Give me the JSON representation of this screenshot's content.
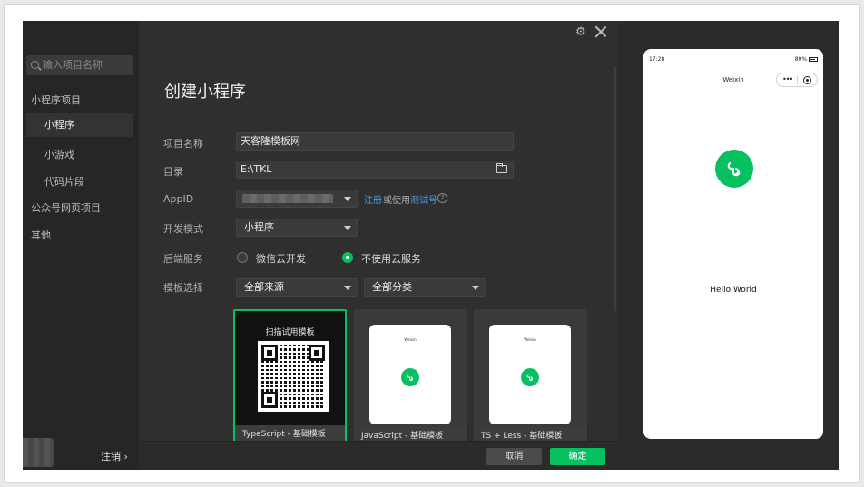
{
  "sidebar": {
    "search_placeholder": "输入项目名称",
    "items": [
      {
        "label": "小程序项目"
      },
      {
        "label": "小程序"
      },
      {
        "label": "小游戏"
      },
      {
        "label": "代码片段"
      },
      {
        "label": "公众号网页项目"
      },
      {
        "label": "其他"
      }
    ],
    "logout_label": "注销 ›"
  },
  "dialog": {
    "title": "创建小程序",
    "project_name_label": "项目名称",
    "project_name_value": "天客隆模板网",
    "directory_label": "目录",
    "directory_value": "E:\\TKL",
    "appid_label": "AppID",
    "register_link": "注册",
    "or_use_text": "或使用",
    "test_account_link": "测试号",
    "dev_mode_label": "开发模式",
    "dev_mode_value": "小程序",
    "backend_label": "后端服务",
    "backend_option_cloud": "微信云开发",
    "backend_option_none": "不使用云服务",
    "template_label": "模板选择",
    "template_source_value": "全部来源",
    "template_category_value": "全部分类",
    "templates": [
      {
        "name": "TypeScript - 基础模板",
        "overlay": "扫描试用模板"
      },
      {
        "name": "JavaScript - 基础模板"
      },
      {
        "name": "TS + Less - 基础模板"
      }
    ],
    "cancel_label": "取消",
    "confirm_label": "确定"
  },
  "preview": {
    "status_time": "17:28",
    "battery": "80%",
    "nav_title": "Weixin",
    "capsule_dots": "•••",
    "hello_text": "Hello World"
  },
  "colors": {
    "accent": "#07c160",
    "link": "#4a9ee8"
  }
}
